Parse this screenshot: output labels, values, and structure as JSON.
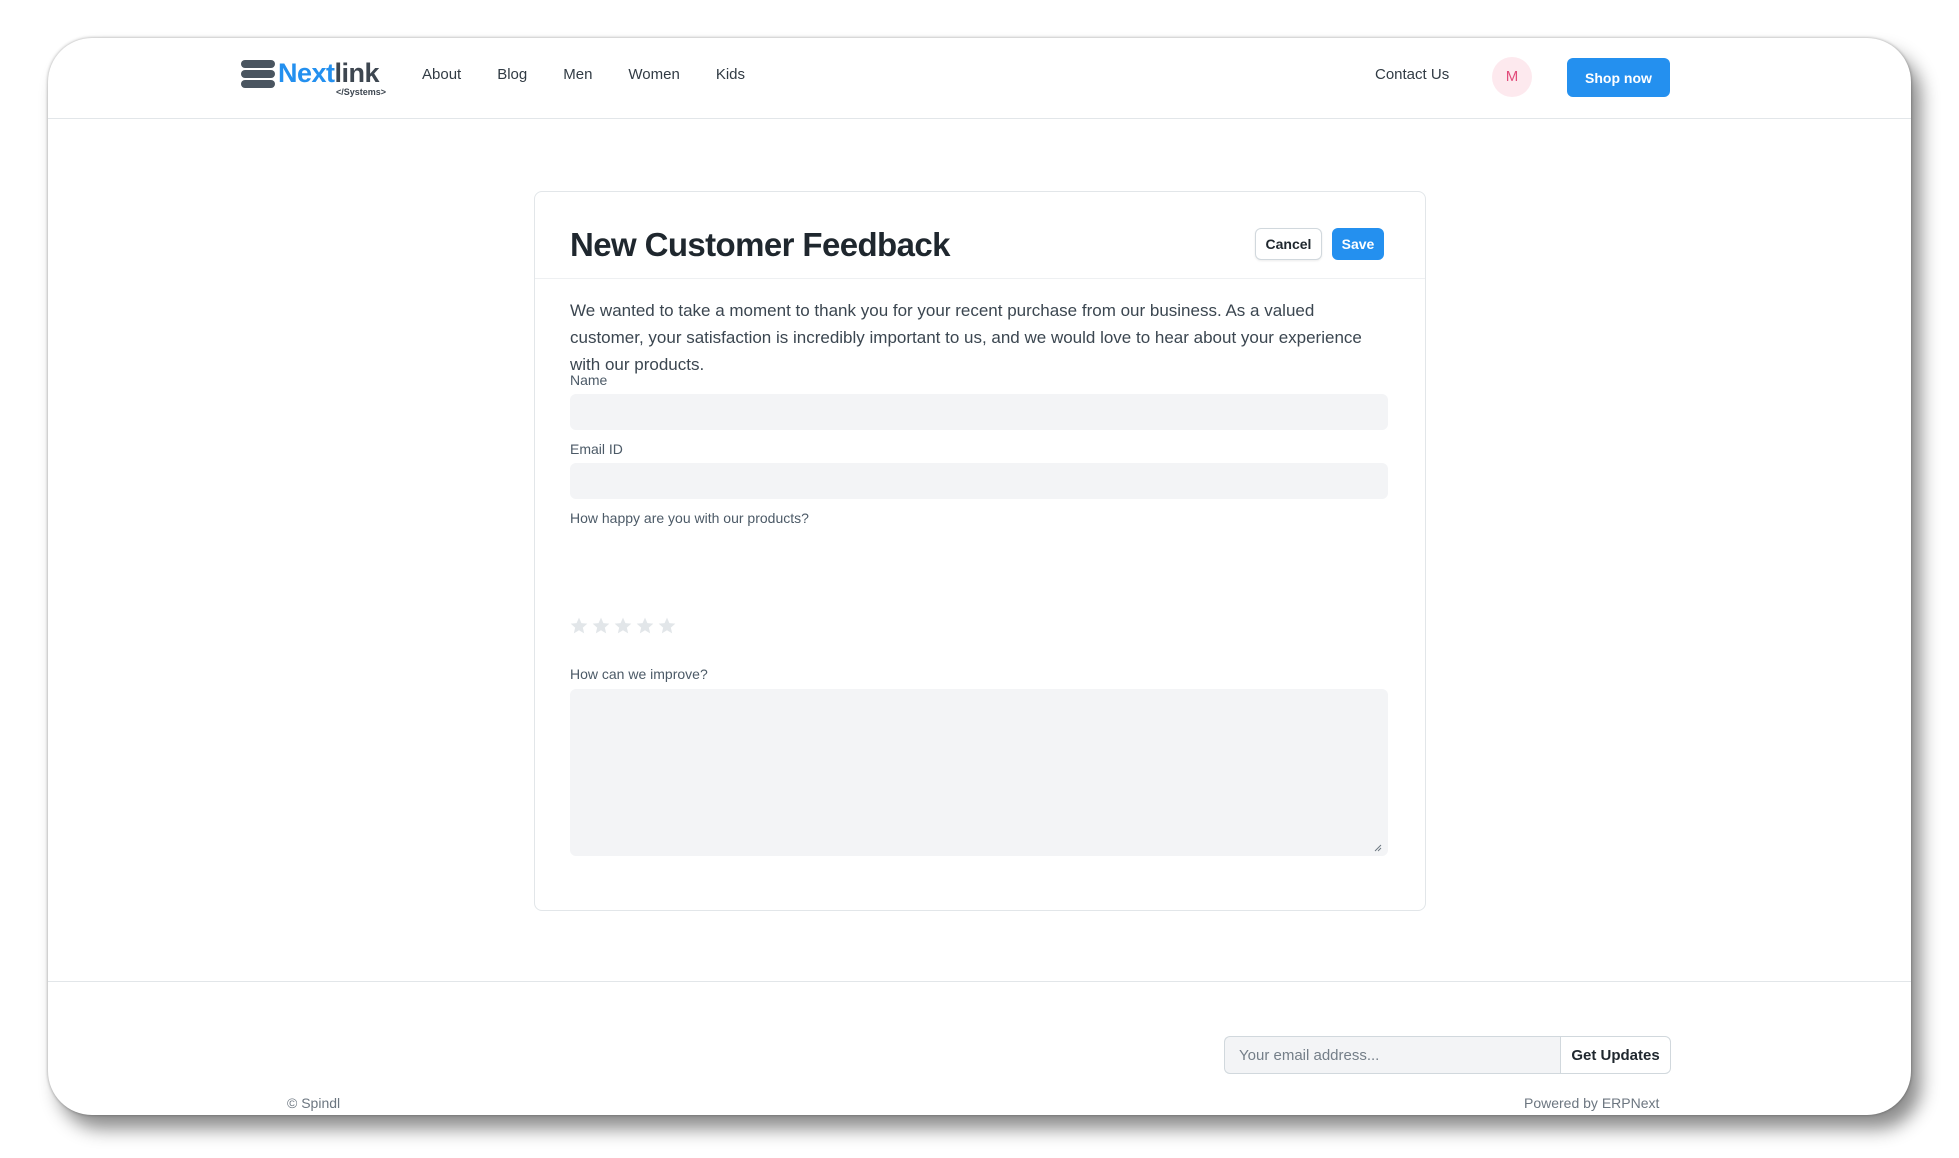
{
  "brand": {
    "name_part1": "Next",
    "name_part2": "link",
    "tagline": "</Systems>",
    "accent_color": "#2490ef"
  },
  "nav": {
    "links": [
      {
        "label": "About"
      },
      {
        "label": "Blog"
      },
      {
        "label": "Men"
      },
      {
        "label": "Women"
      },
      {
        "label": "Kids"
      }
    ],
    "contact_label": "Contact Us",
    "avatar_initial": "M",
    "shop_label": "Shop now"
  },
  "form": {
    "title": "New Customer Feedback",
    "cancel_label": "Cancel",
    "save_label": "Save",
    "intro": "We wanted to take a moment to thank you for your recent purchase from our business. As a valued customer, your satisfaction is incredibly important to us, and we would love to hear about your experience with our products.",
    "fields": {
      "name": {
        "label": "Name",
        "value": ""
      },
      "email": {
        "label": "Email ID",
        "value": ""
      },
      "rating": {
        "label": "How happy are you with our products?",
        "max": 5,
        "value": 0
      },
      "improve": {
        "label": "How can we improve?",
        "value": ""
      }
    }
  },
  "footer": {
    "email_placeholder": "Your email address...",
    "updates_label": "Get Updates",
    "copyright": "© Spindl",
    "powered_by": "Powered by ERPNext"
  }
}
